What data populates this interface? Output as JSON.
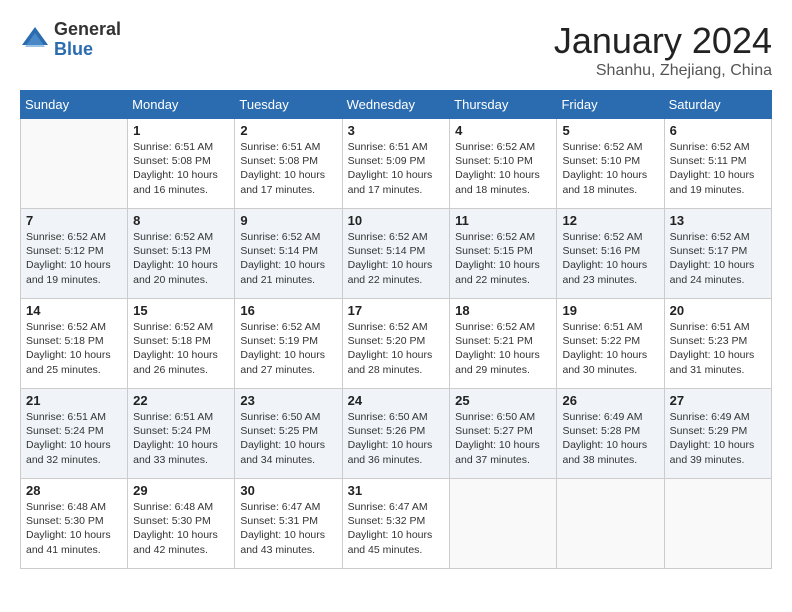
{
  "logo": {
    "general": "General",
    "blue": "Blue"
  },
  "title": "January 2024",
  "location": "Shanhu, Zhejiang, China",
  "days_of_week": [
    "Sunday",
    "Monday",
    "Tuesday",
    "Wednesday",
    "Thursday",
    "Friday",
    "Saturday"
  ],
  "weeks": [
    [
      {
        "day": "",
        "info": ""
      },
      {
        "day": "1",
        "info": "Sunrise: 6:51 AM\nSunset: 5:08 PM\nDaylight: 10 hours\nand 16 minutes."
      },
      {
        "day": "2",
        "info": "Sunrise: 6:51 AM\nSunset: 5:08 PM\nDaylight: 10 hours\nand 17 minutes."
      },
      {
        "day": "3",
        "info": "Sunrise: 6:51 AM\nSunset: 5:09 PM\nDaylight: 10 hours\nand 17 minutes."
      },
      {
        "day": "4",
        "info": "Sunrise: 6:52 AM\nSunset: 5:10 PM\nDaylight: 10 hours\nand 18 minutes."
      },
      {
        "day": "5",
        "info": "Sunrise: 6:52 AM\nSunset: 5:10 PM\nDaylight: 10 hours\nand 18 minutes."
      },
      {
        "day": "6",
        "info": "Sunrise: 6:52 AM\nSunset: 5:11 PM\nDaylight: 10 hours\nand 19 minutes."
      }
    ],
    [
      {
        "day": "7",
        "info": "Sunrise: 6:52 AM\nSunset: 5:12 PM\nDaylight: 10 hours\nand 19 minutes."
      },
      {
        "day": "8",
        "info": "Sunrise: 6:52 AM\nSunset: 5:13 PM\nDaylight: 10 hours\nand 20 minutes."
      },
      {
        "day": "9",
        "info": "Sunrise: 6:52 AM\nSunset: 5:14 PM\nDaylight: 10 hours\nand 21 minutes."
      },
      {
        "day": "10",
        "info": "Sunrise: 6:52 AM\nSunset: 5:14 PM\nDaylight: 10 hours\nand 22 minutes."
      },
      {
        "day": "11",
        "info": "Sunrise: 6:52 AM\nSunset: 5:15 PM\nDaylight: 10 hours\nand 22 minutes."
      },
      {
        "day": "12",
        "info": "Sunrise: 6:52 AM\nSunset: 5:16 PM\nDaylight: 10 hours\nand 23 minutes."
      },
      {
        "day": "13",
        "info": "Sunrise: 6:52 AM\nSunset: 5:17 PM\nDaylight: 10 hours\nand 24 minutes."
      }
    ],
    [
      {
        "day": "14",
        "info": "Sunrise: 6:52 AM\nSunset: 5:18 PM\nDaylight: 10 hours\nand 25 minutes."
      },
      {
        "day": "15",
        "info": "Sunrise: 6:52 AM\nSunset: 5:18 PM\nDaylight: 10 hours\nand 26 minutes."
      },
      {
        "day": "16",
        "info": "Sunrise: 6:52 AM\nSunset: 5:19 PM\nDaylight: 10 hours\nand 27 minutes."
      },
      {
        "day": "17",
        "info": "Sunrise: 6:52 AM\nSunset: 5:20 PM\nDaylight: 10 hours\nand 28 minutes."
      },
      {
        "day": "18",
        "info": "Sunrise: 6:52 AM\nSunset: 5:21 PM\nDaylight: 10 hours\nand 29 minutes."
      },
      {
        "day": "19",
        "info": "Sunrise: 6:51 AM\nSunset: 5:22 PM\nDaylight: 10 hours\nand 30 minutes."
      },
      {
        "day": "20",
        "info": "Sunrise: 6:51 AM\nSunset: 5:23 PM\nDaylight: 10 hours\nand 31 minutes."
      }
    ],
    [
      {
        "day": "21",
        "info": "Sunrise: 6:51 AM\nSunset: 5:24 PM\nDaylight: 10 hours\nand 32 minutes."
      },
      {
        "day": "22",
        "info": "Sunrise: 6:51 AM\nSunset: 5:24 PM\nDaylight: 10 hours\nand 33 minutes."
      },
      {
        "day": "23",
        "info": "Sunrise: 6:50 AM\nSunset: 5:25 PM\nDaylight: 10 hours\nand 34 minutes."
      },
      {
        "day": "24",
        "info": "Sunrise: 6:50 AM\nSunset: 5:26 PM\nDaylight: 10 hours\nand 36 minutes."
      },
      {
        "day": "25",
        "info": "Sunrise: 6:50 AM\nSunset: 5:27 PM\nDaylight: 10 hours\nand 37 minutes."
      },
      {
        "day": "26",
        "info": "Sunrise: 6:49 AM\nSunset: 5:28 PM\nDaylight: 10 hours\nand 38 minutes."
      },
      {
        "day": "27",
        "info": "Sunrise: 6:49 AM\nSunset: 5:29 PM\nDaylight: 10 hours\nand 39 minutes."
      }
    ],
    [
      {
        "day": "28",
        "info": "Sunrise: 6:48 AM\nSunset: 5:30 PM\nDaylight: 10 hours\nand 41 minutes."
      },
      {
        "day": "29",
        "info": "Sunrise: 6:48 AM\nSunset: 5:30 PM\nDaylight: 10 hours\nand 42 minutes."
      },
      {
        "day": "30",
        "info": "Sunrise: 6:47 AM\nSunset: 5:31 PM\nDaylight: 10 hours\nand 43 minutes."
      },
      {
        "day": "31",
        "info": "Sunrise: 6:47 AM\nSunset: 5:32 PM\nDaylight: 10 hours\nand 45 minutes."
      },
      {
        "day": "",
        "info": ""
      },
      {
        "day": "",
        "info": ""
      },
      {
        "day": "",
        "info": ""
      }
    ]
  ]
}
